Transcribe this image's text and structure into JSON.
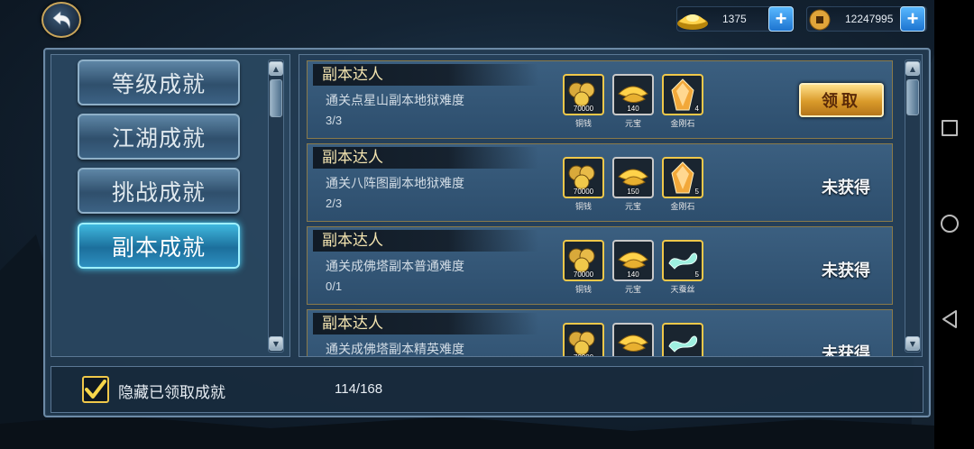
{
  "topbar": {
    "back_icon": "back-arrow-icon",
    "gold_ingot": {
      "icon": "gold-ingot-icon",
      "value": "1375"
    },
    "copper_coin": {
      "icon": "coin-icon",
      "value": "12247995"
    }
  },
  "categories": [
    {
      "label": "等级成就",
      "active": false
    },
    {
      "label": "江湖成就",
      "active": false
    },
    {
      "label": "挑战成就",
      "active": false
    },
    {
      "label": "副本成就",
      "active": true
    }
  ],
  "achievements": [
    {
      "title": "副本达人",
      "desc": "通关点星山副本地狱难度",
      "progress": "3/3",
      "rewards": [
        {
          "icon": "copper-coins-icon",
          "count": "70000",
          "name": "铜钱"
        },
        {
          "icon": "gold-ingot-icon",
          "count": "140",
          "name": "元宝"
        },
        {
          "icon": "diamond-stone-icon",
          "count": "4",
          "name": "金刚石"
        }
      ],
      "action": {
        "type": "button",
        "label": "领取"
      }
    },
    {
      "title": "副本达人",
      "desc": "通关八阵图副本地狱难度",
      "progress": "2/3",
      "rewards": [
        {
          "icon": "copper-coins-icon",
          "count": "70000",
          "name": "铜钱"
        },
        {
          "icon": "gold-ingot-icon",
          "count": "150",
          "name": "元宝"
        },
        {
          "icon": "diamond-stone-icon",
          "count": "5",
          "name": "金刚石"
        }
      ],
      "action": {
        "type": "status",
        "label": "未获得"
      }
    },
    {
      "title": "副本达人",
      "desc": "通关成佛塔副本普通难度",
      "progress": "0/1",
      "rewards": [
        {
          "icon": "copper-coins-icon",
          "count": "70000",
          "name": "铜钱"
        },
        {
          "icon": "gold-ingot-icon",
          "count": "140",
          "name": "元宝"
        },
        {
          "icon": "silk-thread-icon",
          "count": "5",
          "name": "天蚕丝"
        }
      ],
      "action": {
        "type": "status",
        "label": "未获得"
      }
    },
    {
      "title": "副本达人",
      "desc": "通关成佛塔副本精英难度",
      "progress": "",
      "rewards": [
        {
          "icon": "copper-coins-icon",
          "count": "70000",
          "name": ""
        },
        {
          "icon": "gold-ingot-icon",
          "count": "",
          "name": ""
        },
        {
          "icon": "silk-thread-icon",
          "count": "",
          "name": ""
        }
      ],
      "action": {
        "type": "status",
        "label": "未获得"
      }
    }
  ],
  "footer": {
    "hide_claimed_label": "隐藏已领取成就",
    "hide_claimed_checked": true,
    "count": "114/168"
  },
  "colors": {
    "accent_gold": "#f0c84a",
    "active_tab": "#2d8fc0"
  }
}
